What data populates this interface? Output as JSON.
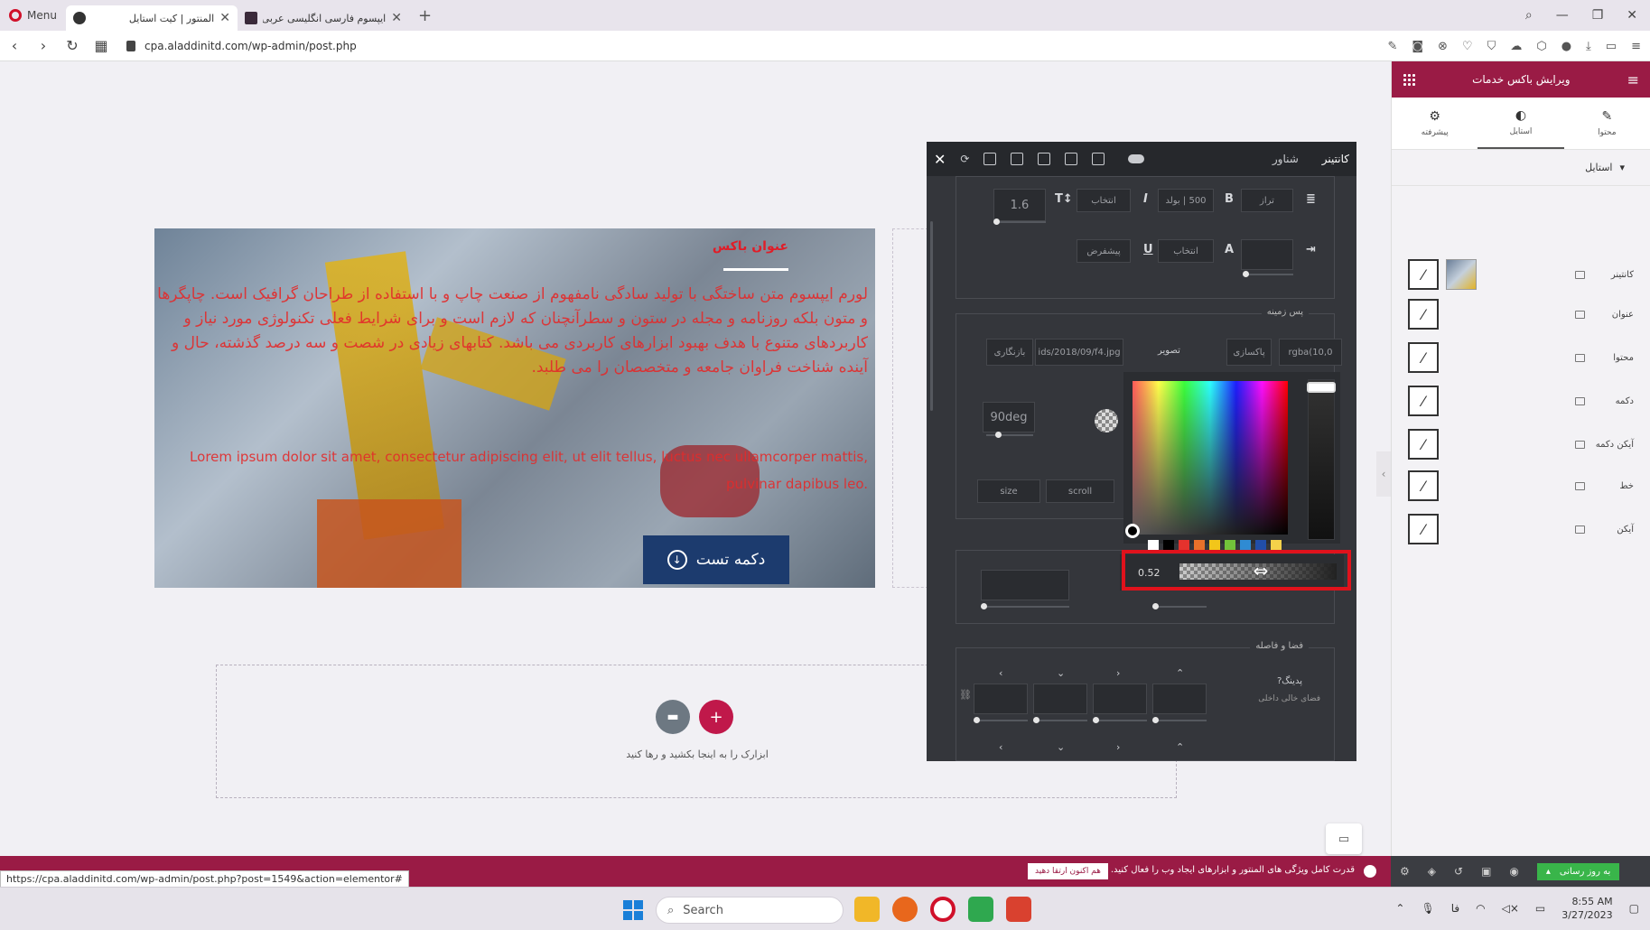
{
  "browser": {
    "menu_label": "Menu",
    "tabs": [
      {
        "title": "المنتور | کیت استایل",
        "active": true
      },
      {
        "title": "ایپسوم فارسی انگلیسی عربی",
        "active": false
      }
    ],
    "url": "cpa.aladdinitd.com/wp-admin/post.php"
  },
  "hero": {
    "title": "عنوان باکس",
    "text": "لورم ایپسوم متن ساختگی با تولید سادگی نامفهوم از صنعت چاپ و با استفاده از طراحان گرافیک است. چاپگرها و متون بلکه روزنامه و مجله در ستون و سطرآنچنان که لازم است و برای شرایط فعلی تکنولوژی مورد نیاز و کاربردهای متنوع با هدف بهبود ابزارهای کاربردی می باشد. کتابهای زیادی در شصت و سه درصد گذشته، حال و آینده شناخت فراوان جامعه و متخصصان را می طلبد.",
    "text_latin": "Lorem ipsum dolor sit amet, consectetur adipiscing elit, ut elit tellus, luctus nec ullamcorper mattis, pulvinar dapibus leo.",
    "button_label": "دکمه تست",
    "button_icon": "arrow-circle-down-icon"
  },
  "dropzone": {
    "text": "ابزارک را به اینجا بکشید و رها کنید"
  },
  "panel": {
    "tabs": [
      "کانتینر",
      "شناور"
    ],
    "typography": {
      "line_height": "1.6",
      "weight": "500 | بولد",
      "choose1": "انتخاب",
      "size_label": "تراز",
      "choose2": "انتخاب",
      "default_label": "پیشفرض"
    },
    "background": {
      "title": "پس زمینه",
      "image_label": "تصویر",
      "image_path": "ids/2018/09/f4.jpg",
      "reset_label": "بازنگاری",
      "clear_label": "پاکسازی",
      "rgba_value": "rgba(10,0",
      "angle": "90deg",
      "size_label": "size",
      "scroll_label": "scroll"
    },
    "spacing": {
      "title": "فضا و فاصله",
      "padding_label": "پدینگ",
      "padding_sub": "فضای خالی داخلی"
    },
    "color_picker": {
      "alpha_value": "0.52",
      "swatches": [
        "#ffffff",
        "#000000",
        "#e5322d",
        "#e8712a",
        "#f2c61a",
        "#72c23a",
        "#2f8bd3",
        "#214ea8",
        "#f5d24a"
      ]
    }
  },
  "sidebar": {
    "header_title": "ویرایش باکس خدمات",
    "tabs": [
      {
        "label": "پیشرفته",
        "icon": "gear-icon"
      },
      {
        "label": "استایل",
        "icon": "contrast-icon"
      },
      {
        "label": "محتوا",
        "icon": "pencil-icon"
      }
    ],
    "section_label": "استایل",
    "rows": [
      "کانتینر",
      "عنوان",
      "محتوا",
      "دکمه",
      "آیکن دکمه",
      "خط",
      "آیکن"
    ]
  },
  "footer": {
    "notice": "قدرت کامل ویژگی های المنتور و ابزارهای ایجاد وب را فعال کنید.",
    "upgrade_label": "هم اکنون ارتقا دهید",
    "publish_label": "به روز رسانی",
    "status_url": "https://cpa.aladdinitd.com/wp-admin/post.php?post=1549&action=elementor#"
  },
  "taskbar": {
    "search_placeholder": "Search",
    "time": "8:55 AM",
    "date": "3/27/2023",
    "lang": "فا"
  },
  "colors": {
    "accent": "#9a1b45",
    "panel": "#34363b",
    "highlight": "#e0121c",
    "hero_button": "#1c3b6e"
  }
}
